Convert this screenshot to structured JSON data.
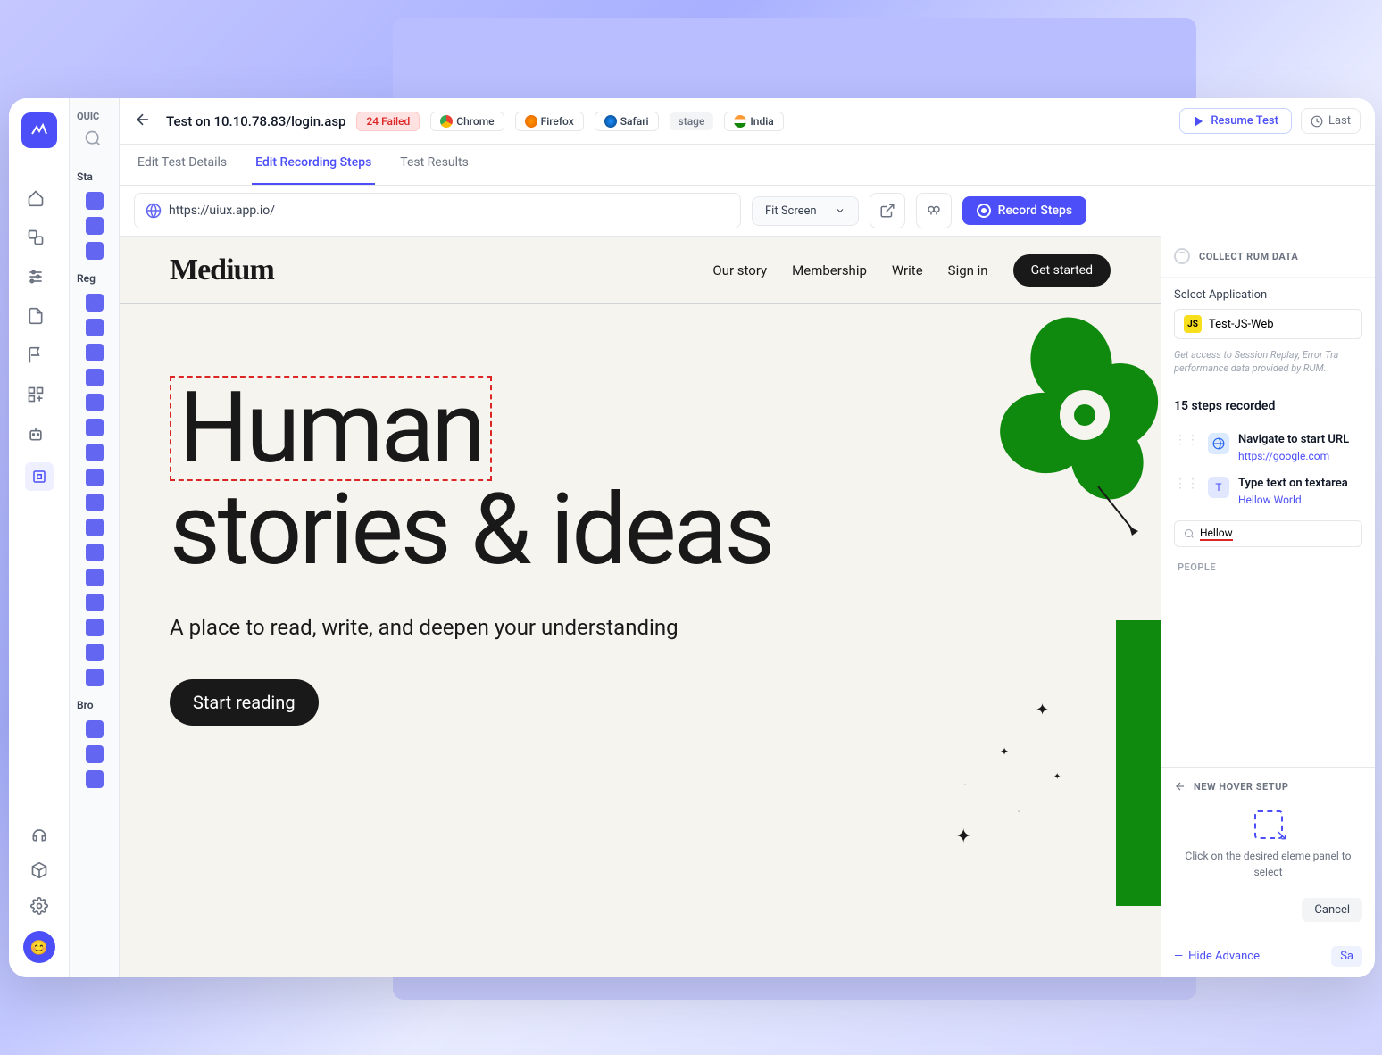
{
  "sidebar": {
    "mid_label": "QUIC",
    "sections": [
      "Sta",
      "Reg",
      "Bro"
    ]
  },
  "topbar": {
    "title": "Test on 10.10.78.83/login.asp",
    "failed_badge": "24 Failed",
    "browsers": [
      "Chrome",
      "Firefox",
      "Safari"
    ],
    "env": "stage",
    "region": "India",
    "resume": "Resume Test",
    "last": "Last"
  },
  "tabs": {
    "edit_details": "Edit Test Details",
    "edit_recording": "Edit Recording Steps",
    "results": "Test Results"
  },
  "urlbar": {
    "url": "https://uiux.app.io/",
    "fit": "Fit Screen",
    "record": "Record Steps"
  },
  "medium": {
    "logo": "Medium",
    "links": [
      "Our story",
      "Membership",
      "Write",
      "Sign in"
    ],
    "cta": "Get started",
    "hero_line1": "Human",
    "hero_line2": "stories & ideas",
    "sub": "A place to read, write, and deepen your understanding",
    "start": "Start reading"
  },
  "rum": {
    "title": "COLLECT RUM DATA",
    "select_label": "Select Application",
    "app_name": "Test-JS-Web",
    "desc": "Get access to Session Replay, Error Tra performance data provided by RUM."
  },
  "steps": {
    "count_label": "15 steps recorded",
    "items": [
      {
        "title": "Navigate to start URL",
        "url": "https://google.com"
      },
      {
        "title": "Type text on textarea",
        "url": "Hellow World"
      }
    ],
    "search_value": "Hellow",
    "people_label": "PEOPLE"
  },
  "hover": {
    "title": "NEW HOVER SETUP",
    "instruction": "Click on the desired eleme panel to select",
    "cancel": "Cancel"
  },
  "footer": {
    "hide": "Hide Advance",
    "save": "Sa"
  }
}
